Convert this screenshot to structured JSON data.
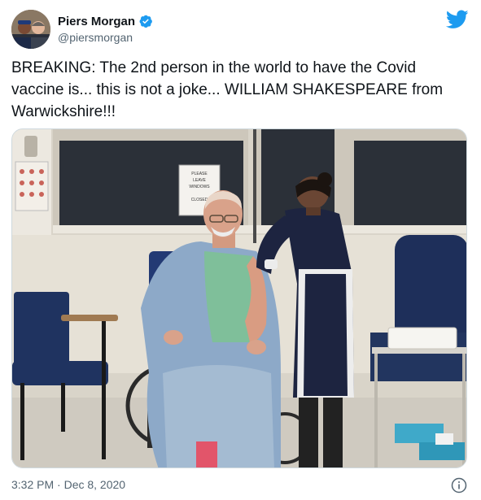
{
  "author": {
    "display_name": "Piers Morgan",
    "handle": "@piersmorgan",
    "verified": true,
    "avatar_icon": "avatar-photo"
  },
  "tweet": {
    "text": "BREAKING: The 2nd person in the world to have the Covid vaccine is... this is not a joke... WILLIAM SHAKESPEARE from Warwickshire!!!",
    "timestamp": "3:32 PM · Dec 8, 2020"
  },
  "media": {
    "window_sign": "PLEASE\nLEAVE\nWINDOWS\n\nCLOSED"
  },
  "icons": {
    "platform": "twitter-bird-icon",
    "verified": "verified-badge-icon",
    "info": "info-icon"
  },
  "colors": {
    "brand": "#1d9bf0",
    "text": "#0f1419",
    "secondary": "#536471"
  }
}
